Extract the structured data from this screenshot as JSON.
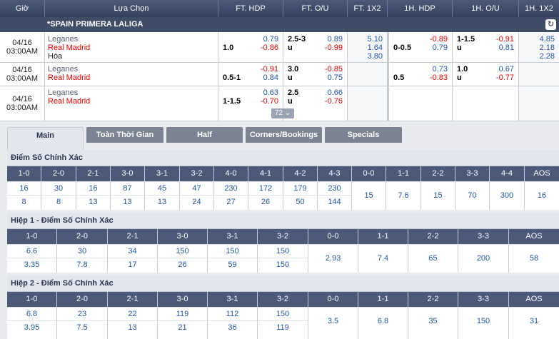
{
  "header": {
    "cols": [
      "Giờ",
      "Lựa Chọn",
      "FT. HDP",
      "FT. O/U",
      "FT. 1X2",
      "1H. HDP",
      "1H. O/U",
      "1H. 1X2"
    ]
  },
  "league": {
    "name": "*SPAIN PRIMERA LALIGA",
    "refresh_icon": "↻"
  },
  "matches": [
    {
      "date": "04/16",
      "time": "03:00AM",
      "home": "Leganes",
      "away": "Real Madrid",
      "draw": "Hòa",
      "ft_hdp": {
        "line": "1.0",
        "home": "0.79",
        "away": "-0.86"
      },
      "ft_ou": {
        "line": "2.5-3",
        "u": "u",
        "over": "0.89",
        "under": "-0.99"
      },
      "ft_1x2": [
        "5.10",
        "1.64",
        "3.80"
      ],
      "h1_hdp": {
        "line": "0-0.5",
        "home": "-0.89",
        "away": "0.79"
      },
      "h1_ou": {
        "line": "1-1.5",
        "u": "u",
        "over": "-0.91",
        "under": "0.81"
      },
      "h1_1x2": [
        "4.85",
        "2.18",
        "2.28"
      ]
    },
    {
      "date": "04/16",
      "time": "03:00AM",
      "home": "Leganes",
      "away": "Real Madrid",
      "ft_hdp": {
        "line": "0.5-1",
        "home": "-0.91",
        "away": "0.84"
      },
      "ft_ou": {
        "line": "3.0",
        "u": "u",
        "over": "-0.85",
        "under": "0.75"
      },
      "h1_hdp": {
        "line": "0.5",
        "home": "0.73",
        "away": "-0.83"
      },
      "h1_ou": {
        "line": "1.0",
        "u": "u",
        "over": "0.67",
        "under": "-0.77"
      }
    },
    {
      "date": "04/16",
      "time": "03:00AM",
      "home": "Leganes",
      "away": "Real Madrid",
      "ft_hdp": {
        "line": "1-1.5",
        "home": "0.63",
        "away": "-0.70"
      },
      "ft_ou": {
        "line": "2.5",
        "u": "u",
        "over": "0.66",
        "under": "-0.76"
      }
    }
  ],
  "more_count": "72 ⌄",
  "tabs": [
    "Main",
    "Toàn Thời Gian",
    "Half",
    "Corners/Bookings",
    "Specials"
  ],
  "sections": [
    {
      "title": "Điểm Số Chính Xác",
      "cols": [
        {
          "h": "1-0",
          "v": [
            "16",
            "8"
          ]
        },
        {
          "h": "2-0",
          "v": [
            "30",
            "8"
          ]
        },
        {
          "h": "2-1",
          "v": [
            "16",
            "13"
          ]
        },
        {
          "h": "3-0",
          "v": [
            "87",
            "13"
          ]
        },
        {
          "h": "3-1",
          "v": [
            "45",
            "13"
          ]
        },
        {
          "h": "3-2",
          "v": [
            "47",
            "24"
          ]
        },
        {
          "h": "4-0",
          "v": [
            "230",
            "27"
          ]
        },
        {
          "h": "4-1",
          "v": [
            "172",
            "26"
          ]
        },
        {
          "h": "4-2",
          "v": [
            "179",
            "50"
          ]
        },
        {
          "h": "4-3",
          "v": [
            "230",
            "144"
          ]
        },
        {
          "h": "0-0",
          "m": "15"
        },
        {
          "h": "1-1",
          "m": "7.6"
        },
        {
          "h": "2-2",
          "m": "15"
        },
        {
          "h": "3-3",
          "m": "70"
        },
        {
          "h": "4-4",
          "m": "300"
        },
        {
          "h": "AOS",
          "m": "16"
        }
      ]
    },
    {
      "title": "Hiệp 1 - Điểm Số Chính Xác",
      "cols": [
        {
          "h": "1-0",
          "v": [
            "6.6",
            "3.35"
          ]
        },
        {
          "h": "2-0",
          "v": [
            "30",
            "7.8"
          ]
        },
        {
          "h": "2-1",
          "v": [
            "34",
            "17"
          ]
        },
        {
          "h": "3-0",
          "v": [
            "150",
            "26"
          ]
        },
        {
          "h": "3-1",
          "v": [
            "150",
            "59"
          ]
        },
        {
          "h": "3-2",
          "v": [
            "150",
            "150"
          ]
        },
        {
          "h": "0-0",
          "m": "2.93"
        },
        {
          "h": "1-1",
          "m": "7.4"
        },
        {
          "h": "2-2",
          "m": "65"
        },
        {
          "h": "3-3",
          "m": "200"
        },
        {
          "h": "AOS",
          "m": "58"
        }
      ]
    },
    {
      "title": "Hiệp 2 - Điểm Số Chính Xác",
      "cols": [
        {
          "h": "1-0",
          "v": [
            "6.8",
            "3.95"
          ]
        },
        {
          "h": "2-0",
          "v": [
            "23",
            "7.5"
          ]
        },
        {
          "h": "2-1",
          "v": [
            "22",
            "13"
          ]
        },
        {
          "h": "3-0",
          "v": [
            "119",
            "21"
          ]
        },
        {
          "h": "3-1",
          "v": [
            "112",
            "36"
          ]
        },
        {
          "h": "3-2",
          "v": [
            "150",
            "119"
          ]
        },
        {
          "h": "0-0",
          "m": "3.5"
        },
        {
          "h": "1-1",
          "m": "6.8"
        },
        {
          "h": "2-2",
          "m": "35"
        },
        {
          "h": "3-3",
          "m": "150"
        },
        {
          "h": "AOS",
          "m": "31"
        }
      ]
    }
  ]
}
